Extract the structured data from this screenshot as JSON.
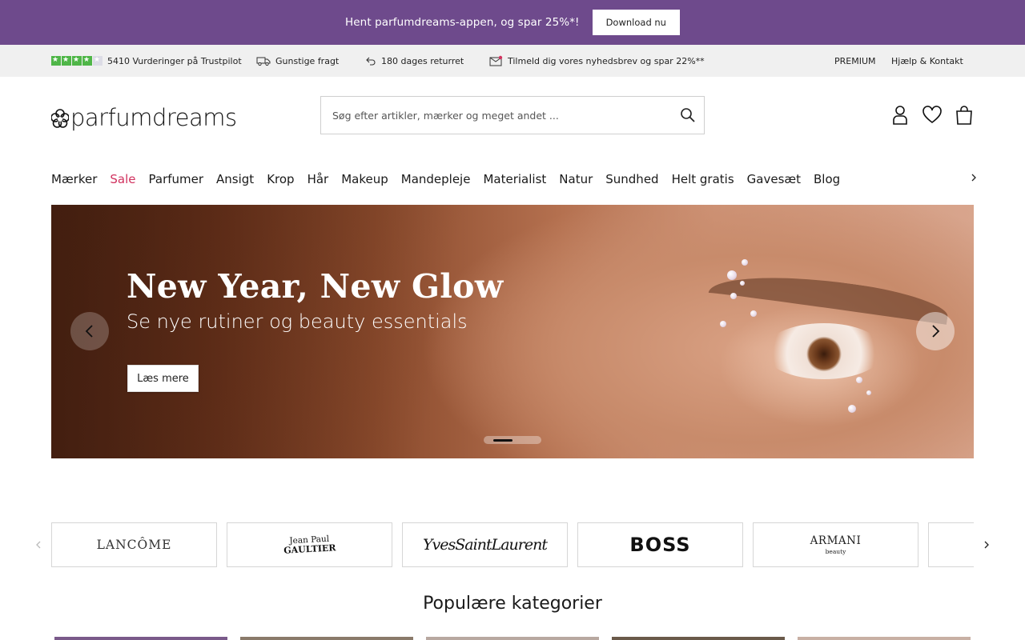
{
  "promo": {
    "text": "Hent parfumdreams-appen, og spar 25%*!",
    "button": "Download nu"
  },
  "infobar": {
    "trustpilot": "5410 Vurderinger på Trustpilot",
    "shipping": "Gunstige fragt",
    "returns": "180 dages returret",
    "newsletter": "Tilmeld dig vores nyhedsbrev og spar 22%**",
    "premium": "PREMIUM",
    "help": "Hjælp & Kontakt",
    "trustpilot_stars": 4,
    "trustpilot_stars_max": 5
  },
  "header": {
    "logo_text": "parfumdreams",
    "search_placeholder": "Søg efter artikler, mærker og meget andet ..."
  },
  "nav": {
    "items": [
      "Mærker",
      "Sale",
      "Parfumer",
      "Ansigt",
      "Krop",
      "Hår",
      "Makeup",
      "Mandepleje",
      "Materialist",
      "Natur",
      "Sundhed",
      "Helt gratis",
      "Gavesæt",
      "Blog"
    ]
  },
  "hero": {
    "title": "New Year, New Glow",
    "subtitle": "Se nye rutiner og beauty essentials",
    "button": "Læs mere"
  },
  "brands": {
    "lancome": "LANCÔME",
    "jpg_line1": "Jean Paul",
    "jpg_line2": "GAULTIER",
    "ysl": "YvesSaintLaurent",
    "boss": "BOSS",
    "armani_line1": "ARMANI",
    "armani_line2": "beauty"
  },
  "sections": {
    "popular_categories": "Populære kategorier"
  },
  "colors": {
    "promo_bg": "#6e4a8c",
    "sale": "#d1325f",
    "trustpilot_green": "#4fb648",
    "infobar_bg": "#f0f0f0"
  },
  "icons": [
    "truck-icon",
    "return-arrow-icon",
    "mail-icon",
    "search-icon",
    "user-icon",
    "heart-icon",
    "bag-icon",
    "chevron-right-icon",
    "chevron-left-icon"
  ]
}
